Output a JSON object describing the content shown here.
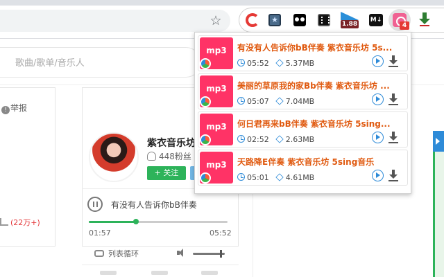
{
  "toolbar": {
    "rating_extension_value": "1.88",
    "markdown_extension_label": "M↓",
    "active_extension_badge": "4"
  },
  "page": {
    "search_placeholder": "歌曲/歌单/音乐人",
    "report_label": "举报",
    "hot_count": "(22万+)",
    "artist": {
      "name": "紫衣音乐坊",
      "fans": "448粉丝",
      "follow_label": "+ 关注"
    },
    "player": {
      "now_playing": "有没有人告诉你bB伴奏",
      "current_time": "01:57",
      "total_time": "05:52",
      "progress_fraction": 0.34,
      "loop_mode_label": "列表循环",
      "volume_fraction": 0.88
    }
  },
  "popup": {
    "thumb_label": "mp3",
    "songs": [
      {
        "title": "有没有人告诉你bB伴奏 紫衣音乐坊 5s...",
        "duration": "05:52",
        "size": "5.37MB"
      },
      {
        "title": "美丽的草原我的家Bb伴奏 紫衣音乐坊 ...",
        "duration": "05:07",
        "size": "7.04MB"
      },
      {
        "title": "何日君再来bB伴奏 紫衣音乐坊 5sing...",
        "duration": "02:52",
        "size": "2.63MB"
      },
      {
        "title": "天路降E伴奏 紫衣音乐坊 5sing音乐",
        "duration": "05:01",
        "size": "4.61MB"
      }
    ]
  },
  "colors": {
    "accent_green": "#2db35a",
    "title_orange": "#e05a10",
    "thumb_pink": "#ff3366",
    "icon_blue": "#2e8bd8"
  }
}
